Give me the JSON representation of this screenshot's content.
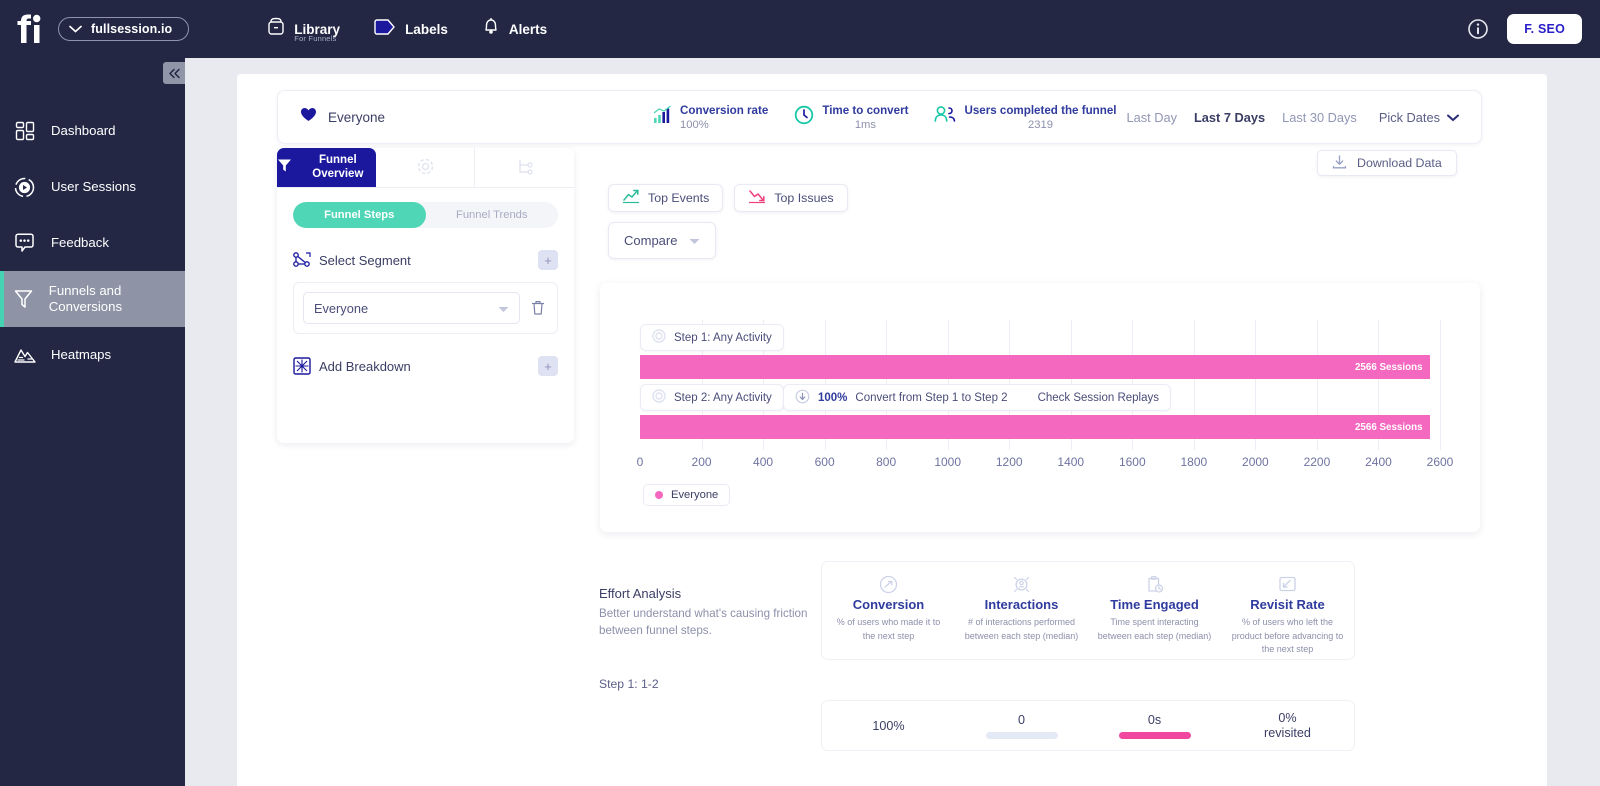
{
  "topbar": {
    "domain": "fullsession.io",
    "nav": [
      {
        "label": "Library",
        "sub": "For Funnels",
        "icon": "library-icon"
      },
      {
        "label": "Labels",
        "sub": "",
        "icon": "label-tag-icon"
      },
      {
        "label": "Alerts",
        "sub": "",
        "icon": "bell-icon"
      }
    ],
    "info_icon": "info-circle-icon",
    "account_button": "F. SEO"
  },
  "sidebar": {
    "collapse_icon": "chevron-double-left-icon",
    "items": [
      {
        "label": "Dashboard",
        "icon": "dashboard-grid-icon",
        "active": false
      },
      {
        "label": "User Sessions",
        "icon": "play-circle-icon",
        "active": false
      },
      {
        "label": "Feedback",
        "icon": "chat-bubble-icon",
        "active": false
      },
      {
        "label": "Funnels and Conversions",
        "icon": "funnel-icon",
        "active": true
      },
      {
        "label": "Heatmaps",
        "icon": "heatmap-mountain-icon",
        "active": false
      }
    ]
  },
  "summary": {
    "segment_name": "Everyone",
    "segment_icon": "heart-icon",
    "metrics": [
      {
        "label": "Conversion rate",
        "value": "100%",
        "icon": "bar-chart-up-icon"
      },
      {
        "label": "Time to convert",
        "value": "1ms",
        "icon": "clock-icon"
      },
      {
        "label": "Users completed the funnel",
        "value": "2319",
        "icon": "users-icon"
      }
    ],
    "ranges": [
      {
        "label": "Last Day",
        "active": false
      },
      {
        "label": "Last 7 Days",
        "active": true
      },
      {
        "label": "Last 30 Days",
        "active": false
      }
    ],
    "pick_dates": "Pick Dates"
  },
  "config": {
    "tabs": [
      {
        "label": "Funnel Overview",
        "icon": "funnel-icon",
        "active": true
      },
      {
        "label": "",
        "icon": "donut-chart-icon",
        "active": false
      },
      {
        "label": "",
        "icon": "flow-branch-icon",
        "active": false
      }
    ],
    "sub_toggle": [
      {
        "label": "Funnel Steps",
        "active": true
      },
      {
        "label": "Funnel Trends",
        "active": false
      }
    ],
    "select_segment_label": "Select Segment",
    "select_segment_icon": "segment-nodes-icon",
    "add_segment_button": "+",
    "segment_value": "Everyone",
    "segment_caret": "caret-down-icon",
    "delete_segment_icon": "trash-icon",
    "add_breakdown_label": "Add Breakdown",
    "add_breakdown_icon": "breakdown-icon",
    "add_breakdown_button": "+"
  },
  "toolbar": {
    "top_events": "Top Events",
    "top_events_icon": "trend-up-icon",
    "top_issues": "Top Issues",
    "top_issues_icon": "trend-down-icon",
    "compare": "Compare",
    "compare_caret": "caret-down-icon",
    "download": "Download Data",
    "download_icon": "download-icon"
  },
  "chart_data": {
    "type": "bar",
    "orientation": "horizontal",
    "title": "",
    "xlabel": "",
    "ylabel": "",
    "xlim": [
      0,
      2600
    ],
    "grid": true,
    "legend_position": "bottom-left",
    "categories": [
      "Step 1: Any Activity",
      "Step 2: Any Activity"
    ],
    "values": [
      2566,
      2566
    ],
    "value_labels": [
      "2566 Sessions",
      "2566 Sessions"
    ],
    "tick_labels": [
      "0",
      "200",
      "400",
      "600",
      "800",
      "1000",
      "1200",
      "1400",
      "1600",
      "1800",
      "2000",
      "2200",
      "2400",
      "2600"
    ],
    "tick_values": [
      0,
      200,
      400,
      600,
      800,
      1000,
      1200,
      1400,
      1600,
      1800,
      2000,
      2200,
      2400,
      2600
    ],
    "series": [
      {
        "name": "Everyone",
        "color": "#f568c0",
        "values": [
          2566,
          2566
        ]
      }
    ],
    "annotations": [
      {
        "step_icon": "step-circle-icon",
        "percent": "100%",
        "text": "Convert from Step 1 to Step 2",
        "link": "Check Session Replays",
        "icon": "arrow-down-circle-icon"
      }
    ],
    "legend": [
      "Everyone"
    ]
  },
  "effort": {
    "title": "Effort Analysis",
    "description": "Better understand what's causing friction between funnel steps.",
    "step_label": "Step 1: 1-2",
    "metrics": [
      {
        "name": "Conversion",
        "desc": "% of users who made it to the next step",
        "icon": "gauge-icon"
      },
      {
        "name": "Interactions",
        "desc": "# of interactions performed between each step (median)",
        "icon": "interaction-icon"
      },
      {
        "name": "Time Engaged",
        "desc": "Time spent interacting between each step (median)",
        "icon": "clipboard-clock-icon"
      },
      {
        "name": "Revisit Rate",
        "desc": "% of users who left the product before advancing to the next step",
        "icon": "exit-arrow-icon"
      }
    ],
    "values": [
      {
        "value": "100%",
        "sub": "",
        "bar": "none"
      },
      {
        "value": "0",
        "sub": "",
        "bar": "grey"
      },
      {
        "value": "0s",
        "sub": "",
        "bar": "pink"
      },
      {
        "value": "0%",
        "sub": "revisited",
        "bar": "none"
      }
    ]
  },
  "colors": {
    "brand_navy": "#232744",
    "accent_blue": "#1b189e",
    "accent_teal": "#4ed6b6",
    "accent_pink": "#f568c0",
    "bar_pink": "#f1479e"
  }
}
